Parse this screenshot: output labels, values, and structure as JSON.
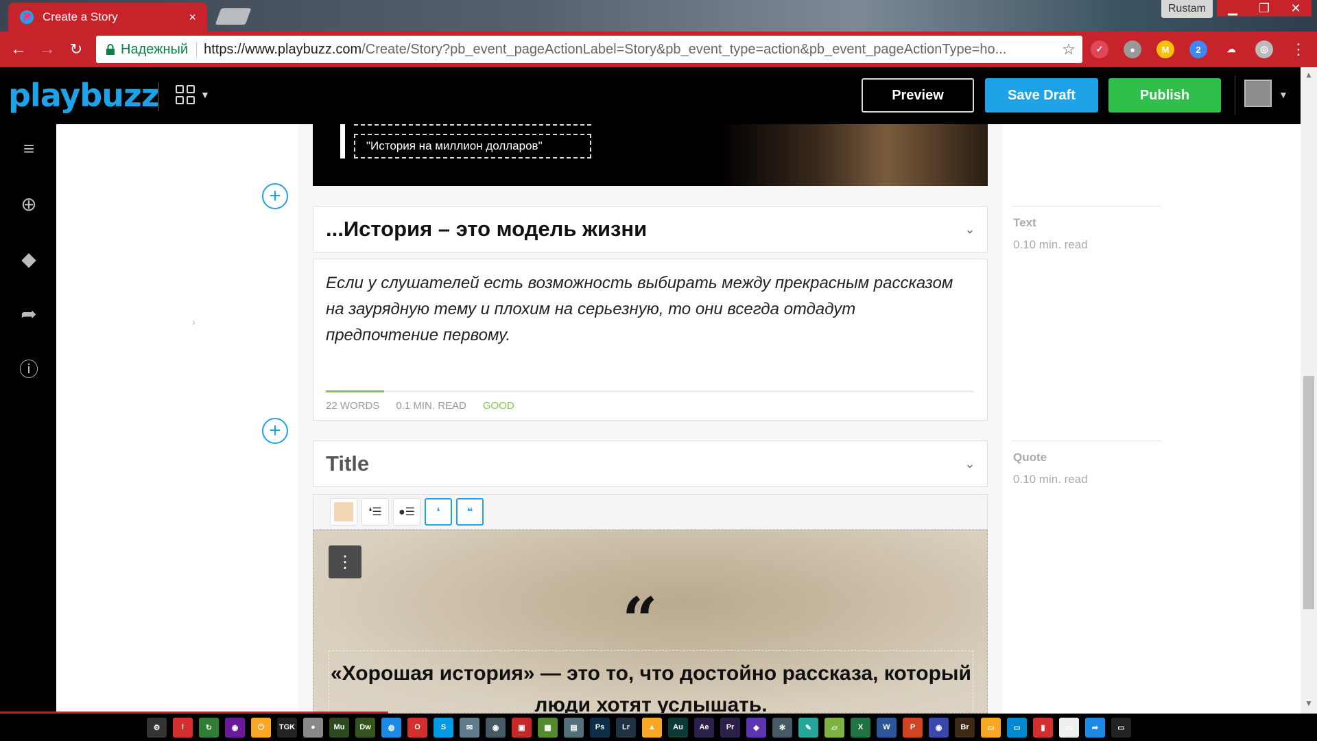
{
  "browser": {
    "tab_title": "Create a Story",
    "tab_close": "×",
    "user_name": "Rustam",
    "secure_label": "Надежный",
    "url_host": "https://www.playbuzz.com",
    "url_path": "/Create/Story?pb_event_pageActionLabel=Story&pb_event_type=action&pb_event_pageActionType=ho...",
    "star": "☆",
    "extensions": [
      {
        "name": "pocket-icon",
        "label": "✓",
        "color": "#e0485a"
      },
      {
        "name": "location-icon",
        "label": "●",
        "color": "#999"
      },
      {
        "name": "m-extension-icon",
        "label": "M",
        "color": "#f4c20d"
      },
      {
        "name": "badge-extension-icon",
        "label": "2",
        "color": "#4285f4"
      },
      {
        "name": "cloud-icon",
        "label": "☁",
        "color": "#c7232a"
      },
      {
        "name": "globe-icon",
        "label": "◎",
        "color": "#bbb"
      }
    ]
  },
  "app": {
    "logo": "playbuzz",
    "preview_label": "Preview",
    "save_label": "Save Draft",
    "publish_label": "Publish"
  },
  "hero": {
    "tag_text": "\"История на миллион долларов\""
  },
  "sections": {
    "text_title": "...История – это модель жизни",
    "text_body": "Если у слушателей есть возможность выбирать между прекрасным рассказом на заурядную тему и плохим на серьезную, то они всегда отдадут предпочтение первому.",
    "words": "22 WORDS",
    "read_time": "0.1 MIN. READ",
    "quality": "GOOD",
    "quality_fraction": 0.09,
    "quote_title": "Title",
    "quote_mark": "“",
    "quote_text": "«Хорошая история» — это то, что достойно рассказа, который люди хотят услышать."
  },
  "sidebar_right": {
    "items": [
      {
        "label": "Text",
        "sub": "0.10 min. read"
      },
      {
        "label": "Quote",
        "sub": "0.10 min. read"
      }
    ]
  },
  "taskbar": {
    "apps": [
      {
        "name": "settings-gear-icon",
        "label": "⚙",
        "color": "#333"
      },
      {
        "name": "red-app-icon",
        "label": "!",
        "color": "#d32f2f"
      },
      {
        "name": "green-sync-icon",
        "label": "↻",
        "color": "#2e7d32"
      },
      {
        "name": "purple-app-icon",
        "label": "◉",
        "color": "#6a1b9a"
      },
      {
        "name": "power-app-icon",
        "label": "⏻",
        "color": "#f9a825"
      },
      {
        "name": "tgk-icon",
        "label": "TGK",
        "color": "#222"
      },
      {
        "name": "disk-icon",
        "label": "●",
        "color": "#888"
      },
      {
        "name": "muse-icon",
        "label": "Mu",
        "color": "#2d4a1f"
      },
      {
        "name": "dreamweaver-icon",
        "label": "Dw",
        "color": "#35531f"
      },
      {
        "name": "chrome-icon",
        "label": "◍",
        "color": "#1e88e5"
      },
      {
        "name": "opera-icon",
        "label": "O",
        "color": "#d32f2f"
      },
      {
        "name": "skype-icon",
        "label": "S",
        "color": "#039be5"
      },
      {
        "name": "mail-icon",
        "label": "✉",
        "color": "#607d8b"
      },
      {
        "name": "camera-icon",
        "label": "◉",
        "color": "#455a64"
      },
      {
        "name": "media-icon",
        "label": "▣",
        "color": "#c62828"
      },
      {
        "name": "sheet-icon",
        "label": "▦",
        "color": "#558b2f"
      },
      {
        "name": "doc-icon",
        "label": "▤",
        "color": "#546e7a"
      },
      {
        "name": "photoshop-icon",
        "label": "Ps",
        "color": "#0d2d4a"
      },
      {
        "name": "lightroom-icon",
        "label": "Lr",
        "color": "#1f3344"
      },
      {
        "name": "warning-app-icon",
        "label": "▲",
        "color": "#f9a825"
      },
      {
        "name": "audition-icon",
        "label": "Au",
        "color": "#0b3b34"
      },
      {
        "name": "after-effects-icon",
        "label": "Ae",
        "color": "#2c1f4a"
      },
      {
        "name": "premiere-icon",
        "label": "Pr",
        "color": "#2c1f4a"
      },
      {
        "name": "vs-icon",
        "label": "◆",
        "color": "#5e35b1"
      },
      {
        "name": "snowflake-icon",
        "label": "✻",
        "color": "#455a64"
      },
      {
        "name": "pen-icon",
        "label": "✎",
        "color": "#26a69a"
      },
      {
        "name": "green-doc-icon",
        "label": "▱",
        "color": "#7cb342"
      },
      {
        "name": "excel-icon",
        "label": "X",
        "color": "#217346"
      },
      {
        "name": "word-icon",
        "label": "W",
        "color": "#2b579a"
      },
      {
        "name": "powerpoint-icon",
        "label": "P",
        "color": "#d04423"
      },
      {
        "name": "lock-app-icon",
        "label": "◉",
        "color": "#3949ab"
      },
      {
        "name": "bridge-icon",
        "label": "Br",
        "color": "#3d2a14"
      },
      {
        "name": "folder-icon",
        "label": "▭",
        "color": "#f9a825"
      },
      {
        "name": "monitor-icon",
        "label": "▭",
        "color": "#0288d1"
      },
      {
        "name": "trash-icon",
        "label": "▮",
        "color": "#d32f2f"
      },
      {
        "name": "notes-icon",
        "label": "▭",
        "color": "#eeeeee"
      },
      {
        "name": "share-icon",
        "label": "➦",
        "color": "#1e88e5"
      },
      {
        "name": "battery-icon",
        "label": "▭",
        "color": "#222"
      }
    ]
  }
}
